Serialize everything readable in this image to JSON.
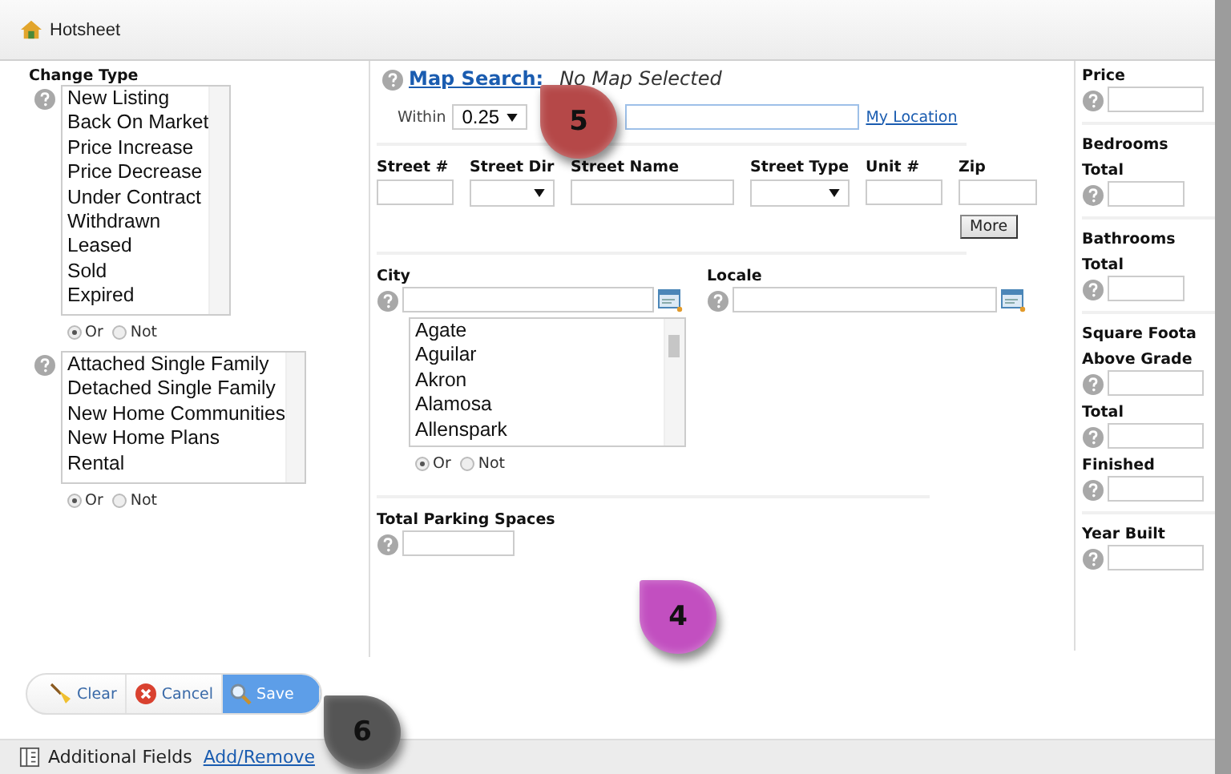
{
  "window": {
    "title": "Hotsheet"
  },
  "change_type": {
    "label": "Change Type",
    "items": [
      "New Listing",
      "Back On Market",
      "Price Increase",
      "Price Decrease",
      "Under Contract",
      "Withdrawn",
      "Leased",
      "Sold",
      "Expired"
    ],
    "radios": [
      {
        "label": "Or",
        "selected": true
      },
      {
        "label": "Not",
        "selected": false
      }
    ]
  },
  "property_type": {
    "items": [
      "Attached Single Family",
      "Detached Single Family",
      "New Home Communities",
      "New Home Plans",
      "Rental"
    ],
    "radios": [
      {
        "label": "Or",
        "selected": true
      },
      {
        "label": "Not",
        "selected": false
      }
    ]
  },
  "map_search": {
    "link": "Map Search:",
    "status": "No Map Selected",
    "within_label": "Within",
    "distance": "0.25",
    "location_link": "My Location"
  },
  "street_fields": [
    {
      "label": "Street #",
      "kind": "text"
    },
    {
      "label": "Street Dir",
      "kind": "select"
    },
    {
      "label": "Street Name",
      "kind": "text"
    },
    {
      "label": "Street Type",
      "kind": "select"
    },
    {
      "label": "Unit #",
      "kind": "text"
    },
    {
      "label": "Zip",
      "kind": "text"
    }
  ],
  "more_button": "More",
  "city": {
    "label": "City",
    "items": [
      "Agate",
      "Aguilar",
      "Akron",
      "Alamosa",
      "Allenspark"
    ],
    "radios": [
      {
        "label": "Or",
        "selected": true
      },
      {
        "label": "Not",
        "selected": false
      }
    ]
  },
  "locale": {
    "label": "Locale"
  },
  "parking": {
    "label": "Total Parking Spaces"
  },
  "right_panel": [
    {
      "items": [
        {
          "kind": "field",
          "label": "Price"
        }
      ]
    },
    {
      "items": [
        {
          "kind": "heading",
          "label": "Bedrooms"
        },
        {
          "kind": "field",
          "label": "Total"
        }
      ]
    },
    {
      "items": [
        {
          "kind": "heading",
          "label": "Bathrooms"
        },
        {
          "kind": "field",
          "label": "Total"
        }
      ]
    },
    {
      "items": [
        {
          "kind": "heading",
          "label": "Square Foota"
        },
        {
          "kind": "field",
          "label": "Above Grade"
        },
        {
          "kind": "field",
          "label": "Total"
        },
        {
          "kind": "field",
          "label": "Finished"
        }
      ]
    },
    {
      "items": [
        {
          "kind": "field",
          "label": "Year Built"
        }
      ]
    }
  ],
  "buttons": [
    {
      "label": "Clear",
      "kind": "clear",
      "highlighted": false
    },
    {
      "label": "Cancel",
      "kind": "cancel",
      "highlighted": false
    },
    {
      "label": "Save",
      "kind": "save",
      "highlighted": true
    }
  ],
  "footer": {
    "label": "Additional Fields",
    "link": "Add/Remove"
  },
  "callouts": [
    {
      "number": "5",
      "color": "#b54848"
    },
    {
      "number": "4",
      "color": "#c24fc0"
    },
    {
      "number": "6",
      "color": "#555555"
    }
  ]
}
